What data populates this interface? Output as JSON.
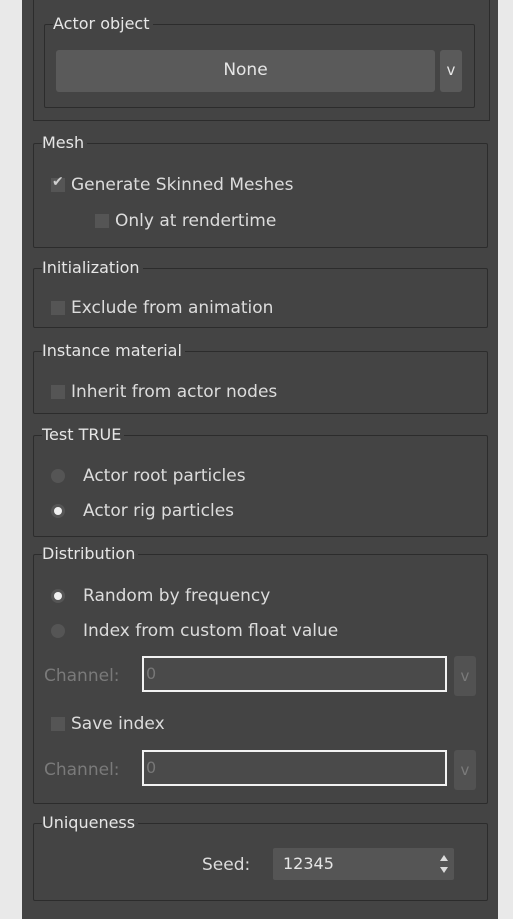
{
  "actor_object": {
    "legend": "Actor object",
    "button_label": "None",
    "dropdown_label": "v"
  },
  "mesh": {
    "legend": "Mesh",
    "generate_skinned": "Generate Skinned Meshes",
    "only_rendertime": "Only at rendertime"
  },
  "initialization": {
    "legend": "Initialization",
    "exclude_anim": "Exclude from animation"
  },
  "instance_material": {
    "legend": "Instance material",
    "inherit": "Inherit from actor nodes"
  },
  "test_true": {
    "legend": "Test TRUE",
    "root_particles": "Actor root particles",
    "rig_particles": "Actor rig particles"
  },
  "distribution": {
    "legend": "Distribution",
    "random_freq": "Random by frequency",
    "index_custom": "Index from custom float value",
    "channel_label": "Channel:",
    "channel1_value": "0",
    "save_index": "Save index",
    "channel2_value": "0",
    "dropdown_label": "v"
  },
  "uniqueness": {
    "legend": "Uniqueness",
    "seed_label": "Seed:",
    "seed_value": "12345"
  },
  "colors": {
    "panel_bg": "#444444",
    "strip_bg": "#e9e9e9",
    "field_border": "#f2f2f2"
  }
}
